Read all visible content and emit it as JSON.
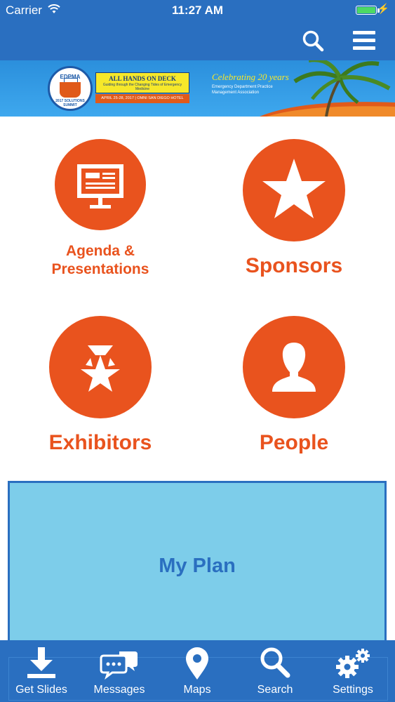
{
  "status_bar": {
    "carrier": "Carrier",
    "time": "11:27 AM"
  },
  "banner": {
    "seal_top": "EDPMA",
    "seal_bottom": "2017 SOLUTIONS SUMMIT",
    "headline": "ALL HANDS ON DECK",
    "subline": "Guiding through the Changing Tides of Emergency Medicine",
    "dates": "APRIL 25-28, 2017 | OMNI SAN DIEGO HOTEL",
    "celebrating": "Celebrating 20 years",
    "association": "Emergency Department Practice Management Association"
  },
  "tiles": [
    {
      "name": "agenda",
      "label_line1": "Agenda &",
      "label_line2": "Presentations",
      "icon": "presentation-board-icon"
    },
    {
      "name": "sponsors",
      "label": "Sponsors",
      "icon": "star-icon"
    },
    {
      "name": "exhibitors",
      "label": "Exhibitors",
      "icon": "ribbon-star-icon"
    },
    {
      "name": "people",
      "label": "People",
      "icon": "person-icon"
    }
  ],
  "my_plan": {
    "label": "My Plan"
  },
  "tab_bar": [
    {
      "label": "Get Slides",
      "icon": "download-icon"
    },
    {
      "label": "Messages",
      "icon": "chat-bubbles-icon"
    },
    {
      "label": "Maps",
      "icon": "map-pin-icon"
    },
    {
      "label": "Search",
      "icon": "search-icon"
    },
    {
      "label": "Settings",
      "icon": "gears-icon"
    }
  ],
  "colors": {
    "brand_blue": "#2a6fc0",
    "accent_orange": "#e9531e",
    "plan_bg": "#7dcdea"
  }
}
